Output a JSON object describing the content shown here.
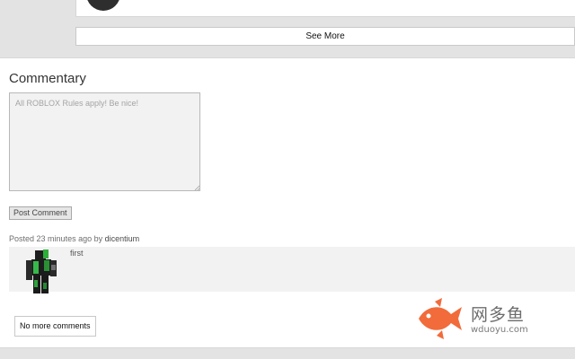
{
  "top": {
    "see_more_label": "See More"
  },
  "commentary": {
    "title": "Commentary",
    "input_placeholder": "All ROBLOX Rules apply! Be nice!",
    "post_button_label": "Post Comment",
    "comments": [
      {
        "posted_prefix": "Posted",
        "time_ago": "23 minutes ago",
        "by_label": "by",
        "username": "dicentium",
        "text": "first"
      }
    ],
    "no_more_label": "No more comments"
  },
  "watermark": {
    "name": "网多鱼",
    "url": "wduoyu.com",
    "icon": "fish-icon",
    "color": "#f26b3a"
  }
}
